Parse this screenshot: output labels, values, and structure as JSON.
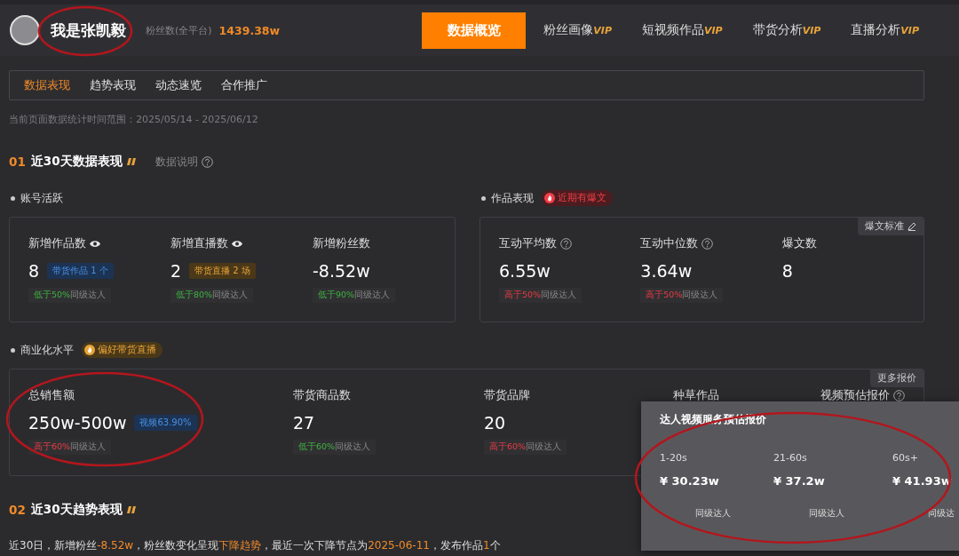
{
  "profile": {
    "name": "我是张凯毅",
    "fans_label": "粉丝数(全平台)",
    "fans_value": "1439.38w"
  },
  "nav": [
    {
      "label": "数据概览",
      "selected": true
    },
    {
      "label": "粉丝画像",
      "badge": "VIP",
      "selected": false
    },
    {
      "label": "短视频作品",
      "badge": "VIP",
      "selected": false
    },
    {
      "label": "带货分析",
      "badge": "VIP",
      "selected": false
    },
    {
      "label": "直播分析",
      "badge": "VIP",
      "selected": false
    }
  ],
  "subtabs": [
    {
      "label": "数据表现",
      "selected": true
    },
    {
      "label": "趋势表现",
      "selected": false
    },
    {
      "label": "动态速览",
      "selected": false
    },
    {
      "label": "合作推广",
      "selected": false
    }
  ],
  "date_range": "当前页面数据统计时间范围：2025/05/14 - 2025/06/12",
  "section_1": {
    "number": "01",
    "title": "近30天数据表现",
    "help": "数据说明"
  },
  "groups": [
    {
      "title": "账号活跃",
      "metrics": [
        {
          "label": "新增作品数",
          "eye_icon": true,
          "value": "8",
          "tag": {
            "text": "带货作品 1 个",
            "kind": "blue"
          },
          "compare": {
            "lead": "低于50%",
            "rest": "同级达人",
            "above": false
          }
        },
        {
          "label": "新增直播数",
          "eye_icon": true,
          "value": "2",
          "tag": {
            "text": "带货直播 2 场",
            "kind": "gold"
          },
          "compare": {
            "lead": "低于80%",
            "rest": "同级达人",
            "above": false
          }
        },
        {
          "label": "新增粉丝数",
          "value": "-8.52w",
          "compare": {
            "lead": "低于90%",
            "rest": "同级达人",
            "above": false
          }
        }
      ]
    },
    {
      "title": "作品表现",
      "badge": {
        "text": "近期有爆文",
        "kind": "red"
      },
      "action": "爆文标准",
      "metrics": [
        {
          "label": "互动平均数",
          "help_icon": true,
          "value": "6.55w",
          "compare": {
            "lead": "高于50%",
            "rest": "同级达人",
            "above": true
          }
        },
        {
          "label": "互动中位数",
          "help_icon": true,
          "value": "3.64w",
          "compare": {
            "lead": "高于50%",
            "rest": "同级达人",
            "above": true
          }
        },
        {
          "label": "爆文数",
          "value": "8"
        }
      ]
    },
    {
      "title": "商业化水平",
      "badge": {
        "text": "偏好带货直播",
        "kind": "gold"
      },
      "action": "更多报价",
      "metrics": [
        {
          "label": "总销售额",
          "value": "250w-500w",
          "tag": {
            "text": "视频63.90%",
            "kind": "blue"
          },
          "compare": {
            "lead": "高于60%",
            "rest": "同级达人",
            "above": true
          }
        },
        {
          "label": "带货商品数",
          "value": "27",
          "compare": {
            "lead": "低于60%",
            "rest": "同级达人",
            "above": false
          }
        },
        {
          "label": "带货品牌",
          "value": "20",
          "compare": {
            "lead": "高于60%",
            "rest": "同级达人",
            "above": true
          }
        },
        {
          "label": "种草作品"
        },
        {
          "label": "视频预估报价",
          "help_icon": true
        }
      ]
    }
  ],
  "popup": {
    "title": "达人视频服务预估报价",
    "items": [
      {
        "range": "1-20s",
        "price": "¥ 30.23w",
        "compare": "同级达人"
      },
      {
        "range": "21-60s",
        "price": "¥ 37.2w",
        "compare": "同级达人"
      },
      {
        "range": "60s+",
        "price": "¥ 41.93w",
        "compare": "同级达"
      }
    ]
  },
  "section_2": {
    "number": "02",
    "title": "近30天趋势表现"
  },
  "summary": [
    {
      "text": "近30日，新增粉丝",
      "highlight": false
    },
    {
      "text": "-8.52w",
      "highlight": true
    },
    {
      "text": "，粉丝数变化呈现",
      "highlight": false
    },
    {
      "text": "下降趋势",
      "highlight": true
    },
    {
      "text": "，最近一次下降节点为",
      "highlight": false
    },
    {
      "text": "2025-06-11",
      "highlight": true
    },
    {
      "text": "，发布作品",
      "highlight": false
    },
    {
      "text": "1",
      "highlight": true
    },
    {
      "text": "个",
      "highlight": false
    }
  ]
}
